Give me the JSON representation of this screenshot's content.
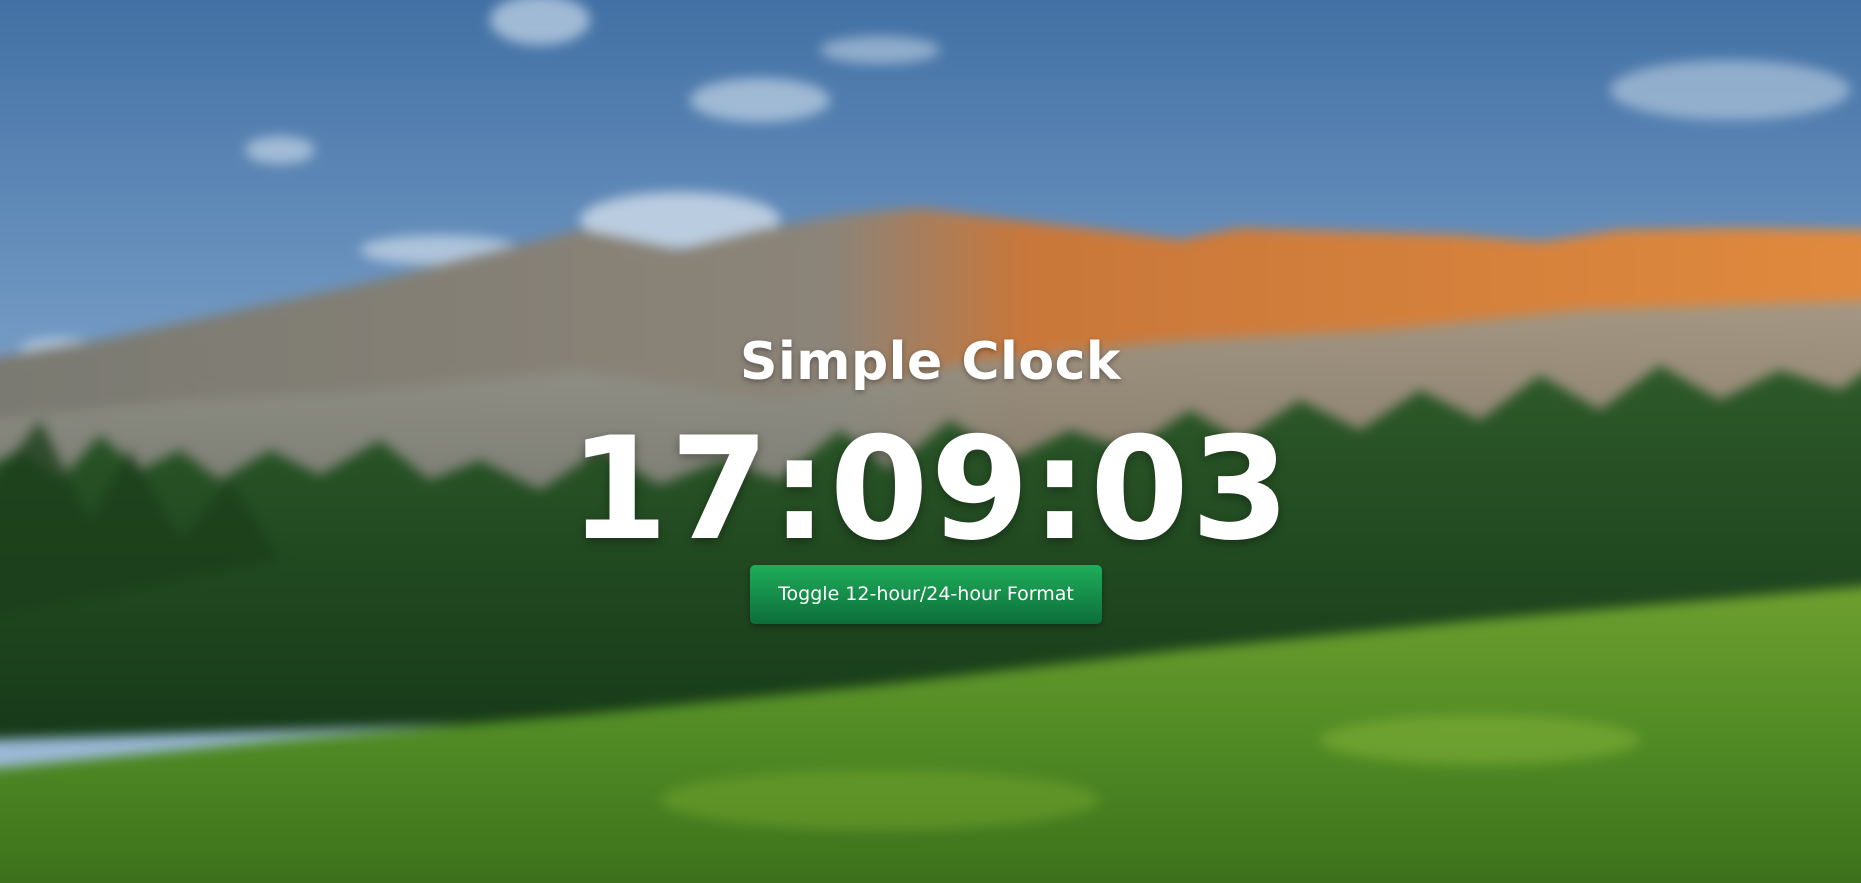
{
  "app": {
    "title": "Simple Clock",
    "time": "17:09:03",
    "toggle_label": "Toggle 12-hour/24-hour Format"
  },
  "colors": {
    "button_top": "#1fae5b",
    "button_bottom": "#0d6e3a",
    "text": "#ffffff"
  },
  "background": {
    "description_icon": "mountain-landscape-image"
  }
}
